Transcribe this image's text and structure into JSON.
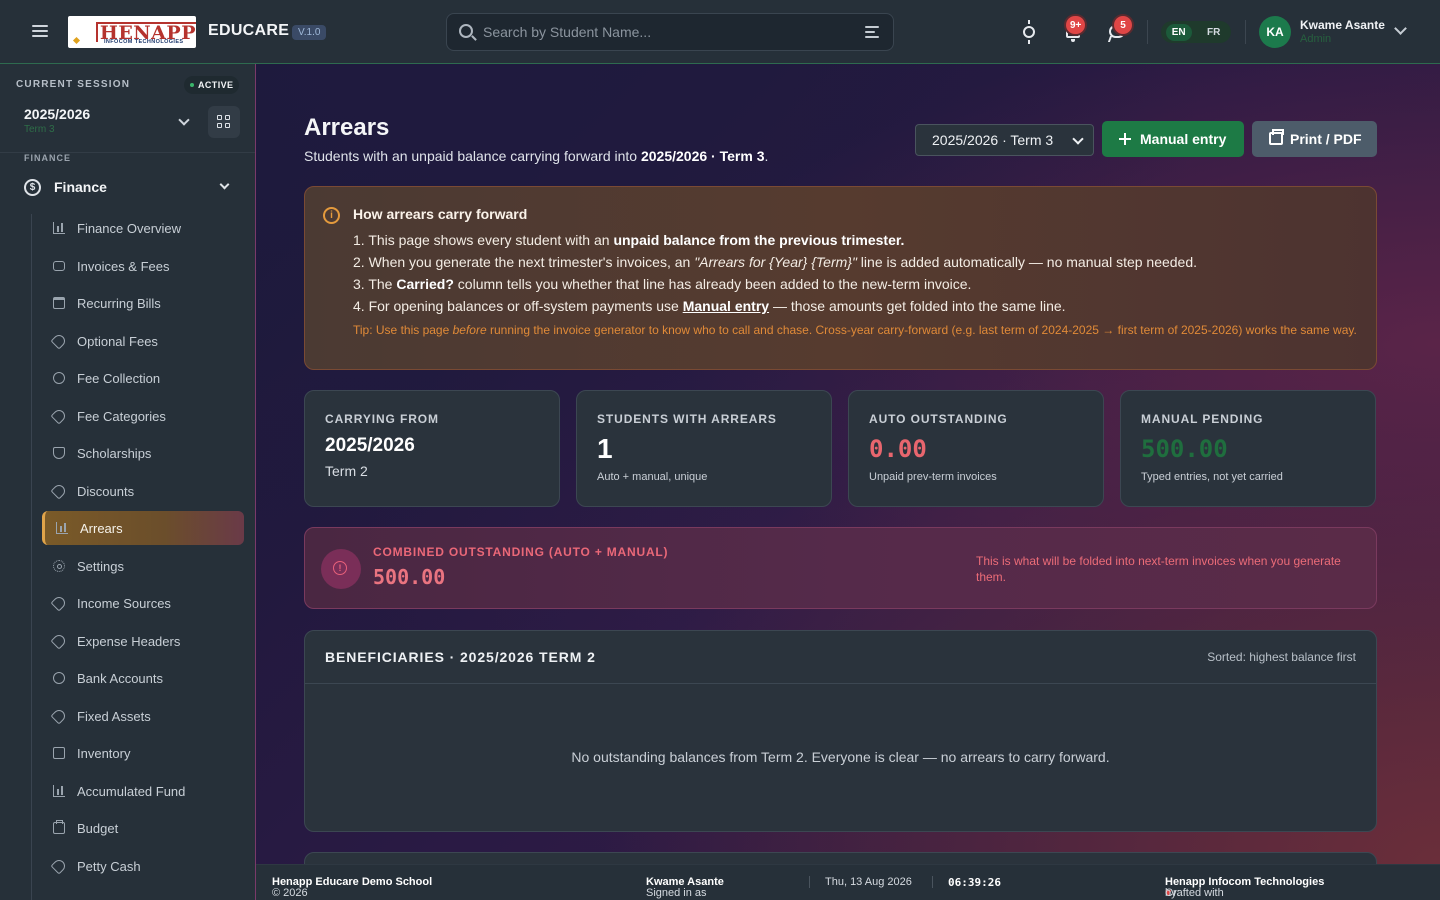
{
  "topbar": {
    "logo_text": "HENAPP",
    "logo_sub": "INFOCOM TECHNOLOGIES",
    "brand": "EDUCARE",
    "version": "V.1.0",
    "search_placeholder": "Search by Student Name...",
    "notif_badge": "9+",
    "msg_badge": "5",
    "lang_en": "EN",
    "lang_fr": "FR",
    "avatar_initials": "KA",
    "user_name": "Kwame Asante",
    "user_role": "Admin"
  },
  "sidebar": {
    "session_label": "CURRENT SESSION",
    "session_badge": "ACTIVE",
    "session_year": "2025/2026",
    "session_term": "Term 3",
    "section_cut_label": "FINANCE",
    "group_label": "Finance",
    "items": [
      {
        "label": "Finance Overview",
        "icon": "bar-chart-icon"
      },
      {
        "label": "Invoices & Fees",
        "icon": "card-icon"
      },
      {
        "label": "Recurring Bills",
        "icon": "calendar-icon"
      },
      {
        "label": "Optional Fees",
        "icon": "tag-icon"
      },
      {
        "label": "Fee Collection",
        "icon": "coin-icon"
      },
      {
        "label": "Fee Categories",
        "icon": "tag-icon"
      },
      {
        "label": "Scholarships",
        "icon": "shield-icon"
      },
      {
        "label": "Discounts",
        "icon": "tag-icon"
      },
      {
        "label": "Arrears",
        "icon": "bar-chart-icon"
      },
      {
        "label": "Settings",
        "icon": "gear-icon"
      },
      {
        "label": "Income Sources",
        "icon": "tag-icon"
      },
      {
        "label": "Expense Headers",
        "icon": "tag-icon"
      },
      {
        "label": "Bank Accounts",
        "icon": "coin-icon"
      },
      {
        "label": "Fixed Assets",
        "icon": "tag-icon"
      },
      {
        "label": "Inventory",
        "icon": "box-icon"
      },
      {
        "label": "Accumulated Fund",
        "icon": "bar-chart-icon"
      },
      {
        "label": "Budget",
        "icon": "clipboard-icon"
      },
      {
        "label": "Petty Cash",
        "icon": "tag-icon"
      }
    ],
    "active_item": "Arrears"
  },
  "header": {
    "title": "Arrears",
    "subtitle_prefix": "Students with an unpaid balance carrying forward into ",
    "subtitle_target": "2025/2026 · Term 3",
    "subtitle_suffix": ".",
    "term_select_value": "2025/2026 · Term 3",
    "manual_entry_label": "Manual entry",
    "print_label": "Print / PDF"
  },
  "info": {
    "title": "How arrears carry forward",
    "line1_a": "1. This page shows every student with an ",
    "line1_b": "unpaid balance from the previous trimester.",
    "line2_a": "2. When you generate the next trimester's invoices, an ",
    "line2_b": "\"Arrears for {Year} {Term}\"",
    "line2_c": " line is added automatically — no manual step needed.",
    "line3_a": "3. The ",
    "line3_b": "Carried?",
    "line3_c": " column tells you whether that line has already been added to the new-term invoice.",
    "line4_a": "4. For opening balances or off-system payments use ",
    "line4_b": "Manual entry",
    "line4_c": " — those amounts get folded into the same line.",
    "tip_a": "Tip: Use this page ",
    "tip_b": "before",
    "tip_c": " running the invoice generator to know who to call and chase. Cross-year carry-forward (e.g. last term of 2024-2025 → first term of 2025-2026) works the same way."
  },
  "stats": {
    "carry_label": "CARRYING FROM",
    "carry_year": "2025/2026",
    "carry_term": "Term 2",
    "students_label": "STUDENTS WITH ARREARS",
    "students_value": "1",
    "students_note": "Auto + manual, unique",
    "auto_label": "AUTO OUTSTANDING",
    "auto_value": "0.00",
    "auto_note": "Unpaid prev-term invoices",
    "manual_label": "MANUAL PENDING",
    "manual_value": "500.00",
    "manual_note": "Typed entries, not yet carried"
  },
  "colors": {
    "auto_value": "#e8666e",
    "manual_value": "#1f6e3e"
  },
  "combined": {
    "label": "COMBINED OUTSTANDING (AUTO + MANUAL)",
    "value": "500.00",
    "note": "This is what will be folded into next-term invoices when you generate them."
  },
  "table": {
    "title": "BENEFICIARIES · 2025/2026 TERM 2",
    "sort_note": "Sorted: highest balance first",
    "empty_message": "No outstanding balances from Term 2. Everyone is clear — no arrears to carry forward."
  },
  "footer": {
    "copyright": "© 2026 ",
    "school": "Henapp Educare Demo School",
    "signed_prefix": "Signed in as ",
    "signed_user": "Kwame Asante",
    "date": "Thu, 13 Aug 2026",
    "clock": "06:39:26",
    "crafted_prefix": "Crafted with ",
    "heart": "♥",
    "crafted_by": " by: ",
    "company": "Henapp Infocom Technologies"
  }
}
